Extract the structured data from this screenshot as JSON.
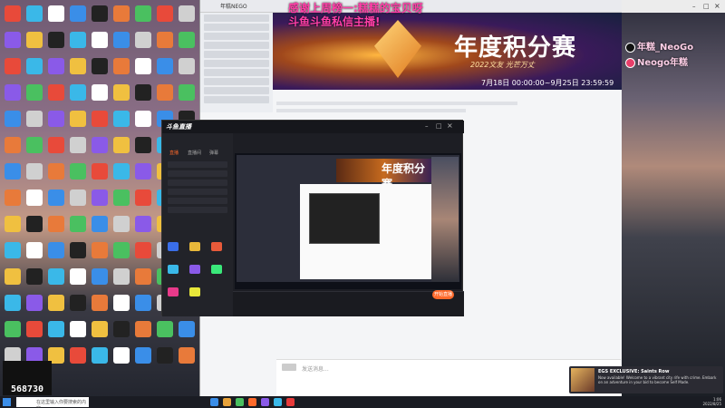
{
  "overlay": {
    "line1": "感谢上周榜一:糕糕的宝贝呀",
    "line2": "斗鱼斗鱼私信主播!"
  },
  "chat": {
    "title": "年糕NEGO",
    "input_placeholder": "发送消息..."
  },
  "banner": {
    "title": "年度积分赛",
    "subtitle": "2022文友",
    "subtitle_tail": "光芒万丈",
    "date": "7月18日 00:00:00~9月25日 23:59:59"
  },
  "social": {
    "tiktok": "年糕_NeoGo",
    "second": "Neogo年糕"
  },
  "app": {
    "logo": "斗鱼直播",
    "tabs": [
      "直播",
      "直播间",
      "弹幕"
    ],
    "start_label": "开始直播",
    "preview_title": "年度积分赛"
  },
  "news": {
    "title": "EGS EXCLUSIVE: Saints Row",
    "body": "Now available! Welcome to a vibrant city rife with crime. Embark on an adventure in your bid to become Self Made."
  },
  "counter": {
    "value": "568730"
  },
  "taskbar": {
    "search_placeholder": "在这里输入你要搜索的内容",
    "time": "1:06",
    "date": "2022/8/25"
  },
  "colors": {
    "overlay_pink": "#ff3fa8",
    "accent_orange": "#ff6a2b"
  }
}
